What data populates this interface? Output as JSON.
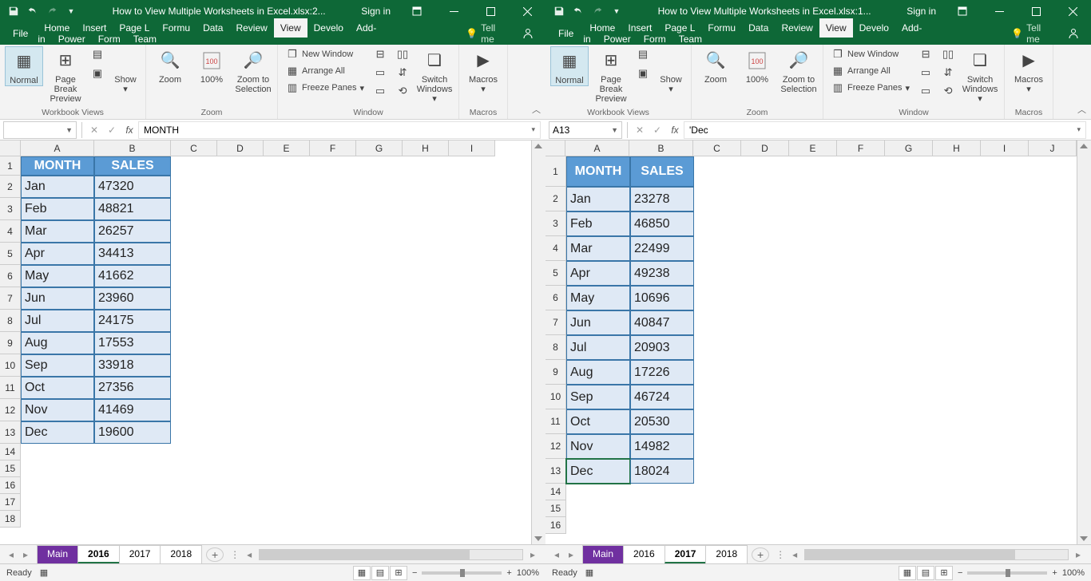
{
  "left": {
    "title": "How to View Multiple Worksheets in Excel.xlsx:2...",
    "signin": "Sign in",
    "name_box": "",
    "formula": "MONTH",
    "active_sheet": "2016",
    "selected_cell": null,
    "data": {
      "headers": [
        "MONTH",
        "SALES"
      ],
      "rows": [
        [
          "Jan",
          "47320"
        ],
        [
          "Feb",
          "48821"
        ],
        [
          "Mar",
          "26257"
        ],
        [
          "Apr",
          "34413"
        ],
        [
          "May",
          "41662"
        ],
        [
          "Jun",
          "23960"
        ],
        [
          "Jul",
          "24175"
        ],
        [
          "Aug",
          "17553"
        ],
        [
          "Sep",
          "33918"
        ],
        [
          "Oct",
          "27356"
        ],
        [
          "Nov",
          "41469"
        ],
        [
          "Dec",
          "19600"
        ]
      ]
    }
  },
  "right": {
    "title": "How to View Multiple Worksheets in Excel.xlsx:1...",
    "signin": "Sign in",
    "name_box": "A13",
    "formula": "'Dec",
    "active_sheet": "2017",
    "selected_cell": "A13",
    "data": {
      "headers": [
        "MONTH",
        "SALES"
      ],
      "rows": [
        [
          "Jan",
          "23278"
        ],
        [
          "Feb",
          "46850"
        ],
        [
          "Mar",
          "22499"
        ],
        [
          "Apr",
          "49238"
        ],
        [
          "May",
          "10696"
        ],
        [
          "Jun",
          "40847"
        ],
        [
          "Jul",
          "20903"
        ],
        [
          "Aug",
          "17226"
        ],
        [
          "Sep",
          "46724"
        ],
        [
          "Oct",
          "20530"
        ],
        [
          "Nov",
          "14982"
        ],
        [
          "Dec",
          "18024"
        ]
      ]
    }
  },
  "menu": {
    "file": "File",
    "tabs": [
      "Home",
      "Insert",
      "Page L",
      "Formu",
      "Data",
      "Review",
      "View",
      "Develo",
      "Add-in",
      "Power",
      "Form",
      "Team"
    ],
    "active": "View",
    "tell_me": "Tell me"
  },
  "ribbon": {
    "group_views": "Workbook Views",
    "normal": "Normal",
    "page_break": "Page Break Preview",
    "show": "Show",
    "group_zoom": "Zoom",
    "zoom": "Zoom",
    "p100": "100%",
    "zoom_sel": "Zoom to Selection",
    "group_window": "Window",
    "new_win": "New Window",
    "arrange": "Arrange All",
    "freeze": "Freeze Panes",
    "switch": "Switch Windows",
    "group_macros": "Macros",
    "macros": "Macros"
  },
  "sheets": [
    "Main",
    "2016",
    "2017",
    "2018"
  ],
  "cols": [
    "A",
    "B",
    "C",
    "D",
    "E",
    "F",
    "G",
    "H",
    "I"
  ],
  "cols_r": [
    "A",
    "B",
    "C",
    "D",
    "E",
    "F",
    "G",
    "H",
    "I",
    "J"
  ],
  "status": {
    "ready": "Ready",
    "zoom": "100%"
  }
}
